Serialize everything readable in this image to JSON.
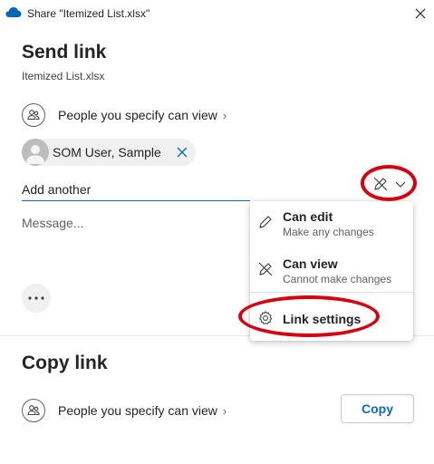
{
  "window": {
    "title": "Share \"Itemized List.xlsx\""
  },
  "send_link": {
    "heading": "Send link",
    "file_name": "Itemized List.xlsx",
    "permission_text": "People you specify can view",
    "recipient_chip": "SOM User, Sample",
    "add_placeholder": "Add another",
    "message_placeholder": "Message..."
  },
  "permission_menu": {
    "items": [
      {
        "title": "Can edit",
        "subtitle": "Make any changes",
        "icon": "pencil-icon"
      },
      {
        "title": "Can view",
        "subtitle": "Cannot make changes",
        "icon": "pencil-slash-icon"
      },
      {
        "title": "Link settings",
        "icon": "gear-icon"
      }
    ]
  },
  "copy_link": {
    "heading": "Copy link",
    "permission_text": "People you specify can view",
    "copy_label": "Copy"
  },
  "colors": {
    "accent": "#0f6cbd",
    "annotation_red": "#d7000f",
    "onedrive_blue": "#0364b8"
  }
}
